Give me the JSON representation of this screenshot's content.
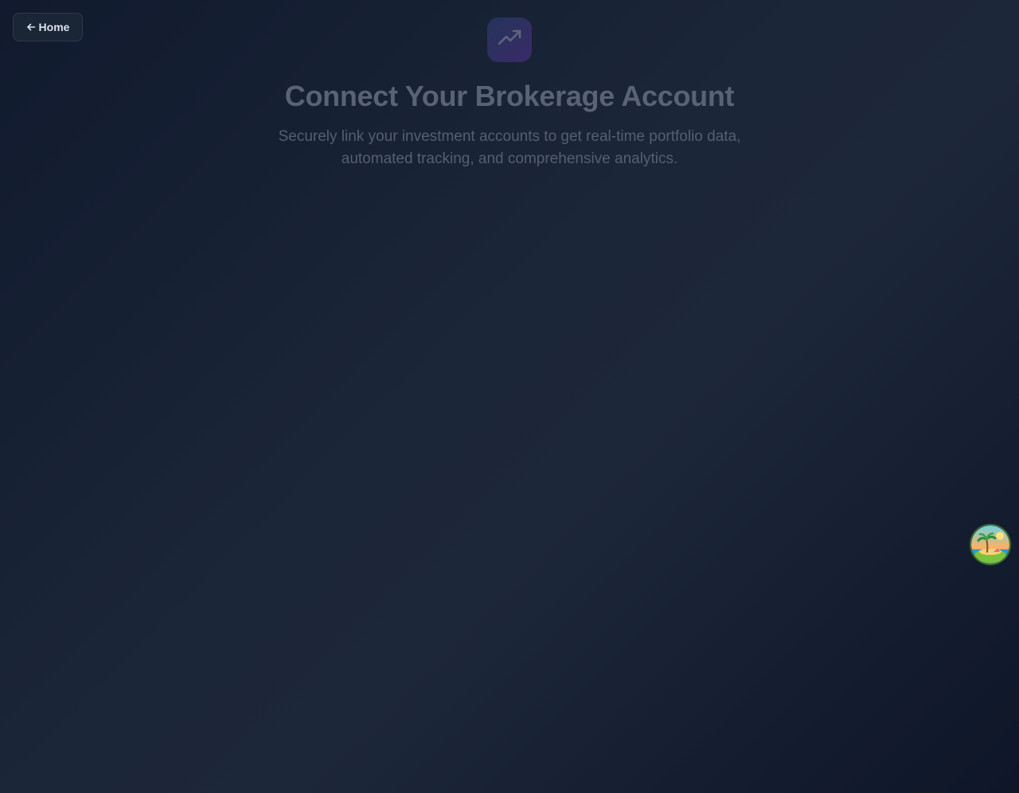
{
  "nav": {
    "home_label": "Home",
    "home_icon": "arrow-left-icon"
  },
  "hero": {
    "logo_icon": "trending-up-icon",
    "title": "Connect Your Brokerage Account",
    "subtitle": "Securely link your investment accounts to get real-time portfolio data, automated tracking, and comprehensive analytics."
  },
  "assistant": {
    "icon": "tropical-island-avatar-icon"
  },
  "colors": {
    "background_start": "#111a2e",
    "background_mid": "#1b2638",
    "logo_gradient_start": "#25345a",
    "logo_gradient_end": "#3a2a68",
    "title": "#596375",
    "subtitle": "#545f71"
  }
}
